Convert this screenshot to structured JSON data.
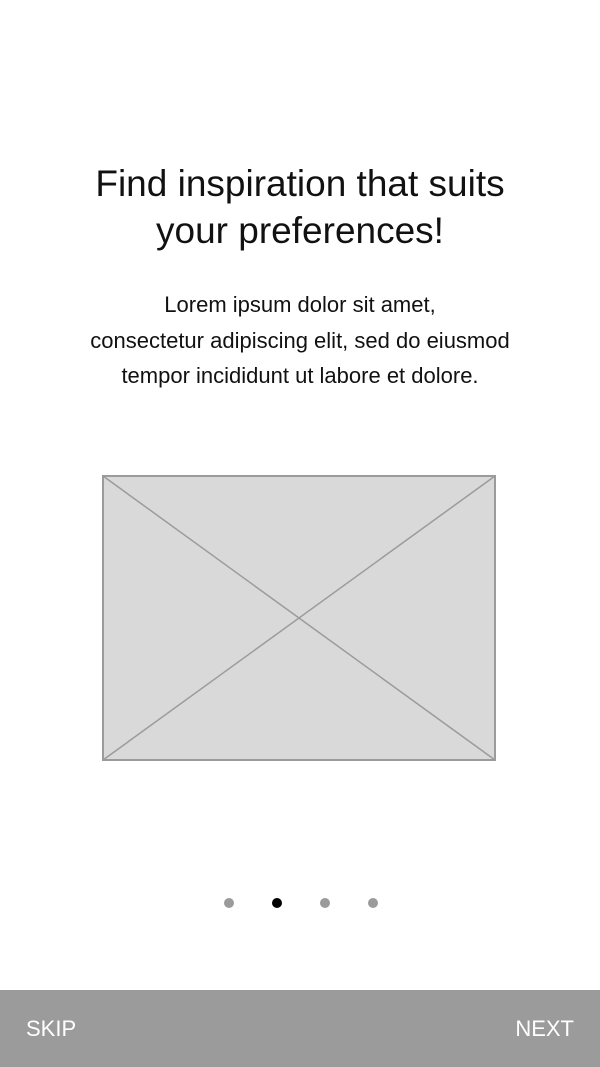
{
  "onboarding": {
    "title_lines": [
      "Find inspiration that suits",
      "your preferences!"
    ],
    "description_lines": [
      "Lorem ipsum dolor sit amet,",
      "consectetur adipiscing elit, sed do eiusmod",
      "tempor incididunt ut labore et dolore."
    ],
    "image_icon": "image-placeholder-icon",
    "pager": {
      "total_pages": 4,
      "current_page": 2
    }
  },
  "bottom_bar": {
    "skip_label": "SKIP",
    "next_label": "NEXT"
  },
  "colors": {
    "background": "#ffffff",
    "text": "#111111",
    "bar": "#9b9b9b",
    "bar_text": "#ffffff",
    "dot_inactive": "#9b9b9b",
    "dot_active": "#000000",
    "placeholder_fill": "#d9d9d9",
    "placeholder_stroke": "#9b9b9b"
  }
}
